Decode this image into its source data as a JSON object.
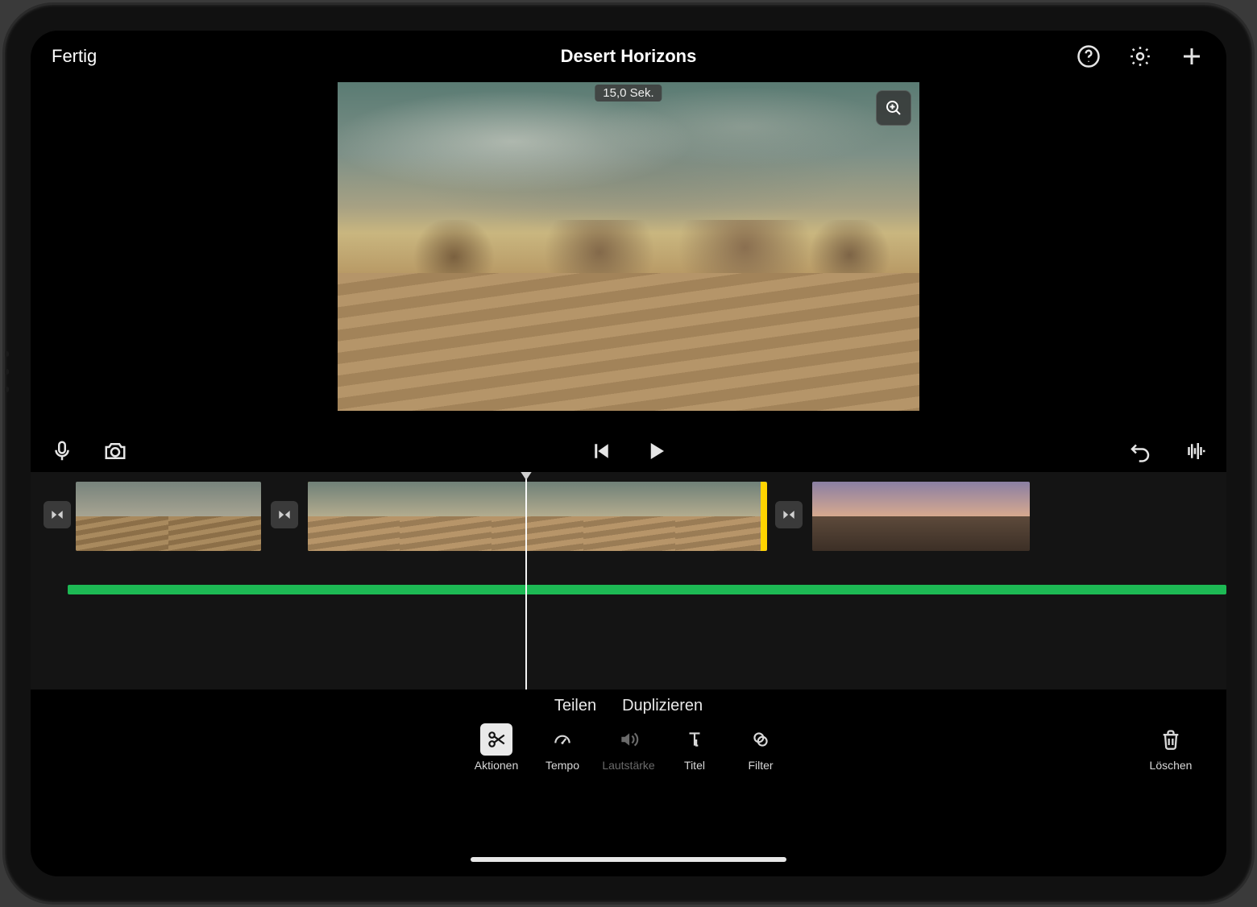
{
  "header": {
    "done_label": "Fertig",
    "title": "Desert Horizons"
  },
  "preview": {
    "duration_label": "15,0 Sek."
  },
  "subactions": {
    "split": "Teilen",
    "duplicate": "Duplizieren"
  },
  "toolbar": {
    "actions": "Aktionen",
    "tempo": "Tempo",
    "volume": "Lautstärke",
    "title": "Titel",
    "filter": "Filter",
    "delete": "Löschen"
  },
  "icons": {
    "help": "help-icon",
    "settings": "gear-icon",
    "add": "plus-icon",
    "mic": "mic-icon",
    "camera": "camera-icon",
    "prev": "skip-back-icon",
    "play": "play-icon",
    "undo": "undo-icon",
    "waveform": "waveform-icon",
    "zoom": "magnify-plus-icon"
  },
  "colors": {
    "selection": "#ffd400",
    "audio_track": "#1db954"
  },
  "timeline": {
    "clips": [
      {
        "id": "clip-1",
        "selected": false,
        "tone": "warm"
      },
      {
        "id": "clip-2",
        "selected": true,
        "tone": "warm"
      },
      {
        "id": "clip-3",
        "selected": false,
        "tone": "dusk"
      }
    ]
  }
}
